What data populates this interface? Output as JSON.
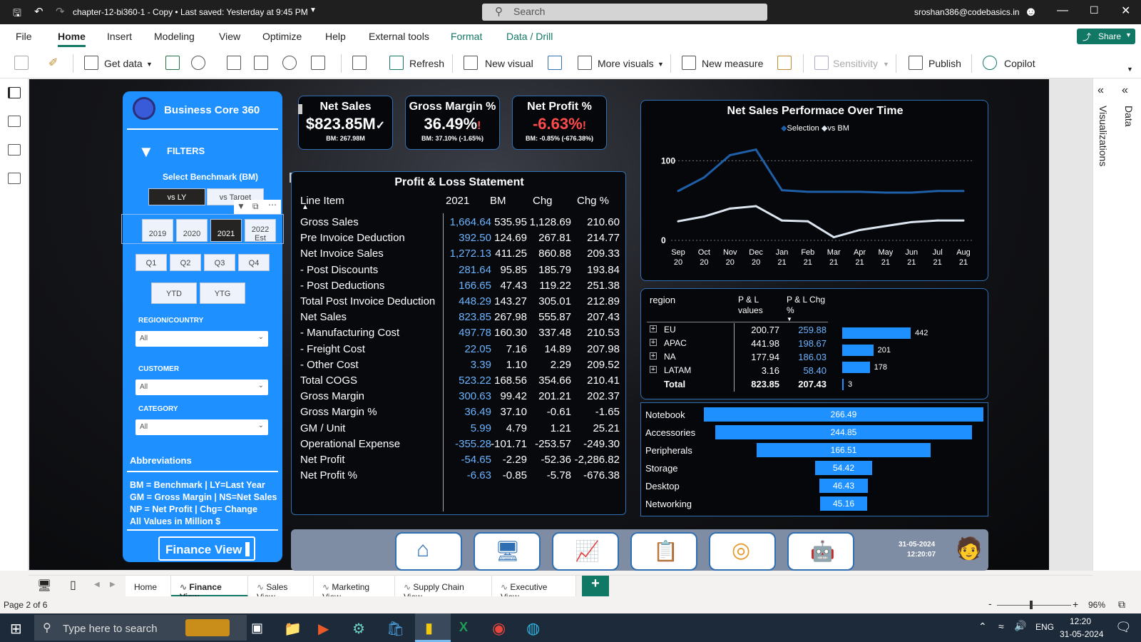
{
  "window": {
    "title": "chapter-12-bi360-1 - Copy • Last saved: Yesterday at 9:45 PM",
    "search_placeholder": "Search",
    "user": "sroshan386@codebasics.in"
  },
  "menu": [
    "File",
    "Home",
    "Insert",
    "Modeling",
    "View",
    "Optimize",
    "Help",
    "External tools",
    "Format",
    "Data / Drill"
  ],
  "share_label": "Share",
  "ribbon": {
    "get_data": "Get data",
    "refresh": "Refresh",
    "new_visual": "New visual",
    "more_visuals": "More visuals",
    "new_measure": "New measure",
    "sensitivity": "Sensitivity",
    "publish": "Publish",
    "copilot": "Copilot"
  },
  "right_panes": {
    "visualizations": "Visualizations",
    "data": "Data"
  },
  "sidebar": {
    "brand": "Business Core 360",
    "filters": "FILTERS",
    "benchmark_label": "Select Benchmark (BM)",
    "benchmark_options": [
      "vs LY",
      "vs Target"
    ],
    "years": [
      "2019",
      "2020",
      "2021",
      "2022 Est"
    ],
    "quarters": [
      "Q1",
      "Q2",
      "Q3",
      "Q4"
    ],
    "ytd": "YTD",
    "ytg": "YTG",
    "region_label": "REGION/COUNTRY",
    "region_value": "All",
    "customer_label": "CUSTOMER",
    "customer_value": "All",
    "category_label": "CATEGORY",
    "category_value": "All",
    "abbrev_title": "Abbreviations",
    "abbrev_lines": [
      "BM = Benchmark | LY=Last Year",
      "GM = Gross Margin | NS=Net Sales",
      "NP = Net Profit | Chg= Change",
      "All Values in Million $"
    ],
    "view_button": "Finance View"
  },
  "kpis": [
    {
      "title": "Net Sales",
      "value": "$823.85M",
      "sub": "BM: 267.98M",
      "color": "#ffffff"
    },
    {
      "title": "Gross Margin %",
      "value": "36.49%",
      "sub": "BM: 37.10% (-1.65%)",
      "color": "#ffffff"
    },
    {
      "title": "Net Profit %",
      "value": "-6.63%",
      "sub": "BM: -0.85% (-676.38%)",
      "color": "#ff4b4b"
    }
  ],
  "pl": {
    "title": "Profit & Loss Statement",
    "headers": [
      "Line Item",
      "2021",
      "BM",
      "Chg",
      "Chg %"
    ],
    "rows": [
      [
        "Gross Sales",
        "1,664.64",
        "535.95",
        "1,128.69",
        "210.60"
      ],
      [
        "Pre Invoice Deduction",
        "392.50",
        "124.69",
        "267.81",
        "214.77"
      ],
      [
        "Net Invoice Sales",
        "1,272.13",
        "411.25",
        "860.88",
        "209.33"
      ],
      [
        "- Post Discounts",
        "281.64",
        "95.85",
        "185.79",
        "193.84"
      ],
      [
        "- Post Deductions",
        "166.65",
        "47.43",
        "119.22",
        "251.38"
      ],
      [
        "Total Post Invoice Deduction",
        "448.29",
        "143.27",
        "305.01",
        "212.89"
      ],
      [
        "Net Sales",
        "823.85",
        "267.98",
        "555.87",
        "207.43"
      ],
      [
        "- Manufacturing Cost",
        "497.78",
        "160.30",
        "337.48",
        "210.53"
      ],
      [
        "- Freight Cost",
        "22.05",
        "7.16",
        "14.89",
        "207.98"
      ],
      [
        "- Other Cost",
        "3.39",
        "1.10",
        "2.29",
        "209.52"
      ],
      [
        "Total COGS",
        "523.22",
        "168.56",
        "354.66",
        "210.41"
      ],
      [
        "Gross Margin",
        "300.63",
        "99.42",
        "201.21",
        "202.37"
      ],
      [
        "Gross Margin %",
        "36.49",
        "37.10",
        "-0.61",
        "-1.65"
      ],
      [
        "GM / Unit",
        "5.99",
        "4.79",
        "1.21",
        "25.21"
      ],
      [
        "Operational Expense",
        "-355.28",
        "-101.71",
        "-253.57",
        "-249.30"
      ],
      [
        "Net Profit",
        "-54.65",
        "-2.29",
        "-52.36",
        "-2,286.82"
      ],
      [
        "Net Profit %",
        "-6.63",
        "-0.85",
        "-5.78",
        "-676.38"
      ]
    ]
  },
  "chart_data": [
    {
      "type": "line",
      "title": "Net Sales Performace Over Time",
      "legend": [
        "Selection",
        "vs BM"
      ],
      "legend_position": "top-center",
      "x": [
        "Sep 20",
        "Oct 20",
        "Nov 20",
        "Dec 20",
        "Jan 21",
        "Feb 21",
        "Mar 21",
        "Apr 21",
        "May 21",
        "Jun 21",
        "Jul 21",
        "Aug 21"
      ],
      "yticks": [
        "100",
        "0"
      ],
      "ylim": [
        0,
        120
      ],
      "series": [
        {
          "name": "Selection",
          "color": "#1f5fa8",
          "values": [
            62,
            79,
            107,
            114,
            63,
            61,
            61,
            61,
            60,
            60,
            62,
            62
          ]
        },
        {
          "name": "vs BM",
          "color": "#dde6f0",
          "values": [
            24,
            30,
            40,
            43,
            25,
            24,
            4,
            13,
            18,
            23,
            25,
            25
          ]
        }
      ]
    },
    {
      "type": "bar",
      "orientation": "horizontal",
      "categories": [
        "Notebook",
        "Accessories",
        "Peripherals",
        "Storage",
        "Desktop",
        "Networking"
      ],
      "values": [
        266.49,
        244.85,
        166.51,
        54.42,
        46.43,
        45.16
      ],
      "value_labels": [
        "266.49",
        "244.85",
        "166.51",
        "54.42",
        "46.43",
        "45.16"
      ]
    }
  ],
  "region_matrix": {
    "headers": [
      "region",
      "P & L values",
      "P & L Chg %"
    ],
    "rows": [
      {
        "name": "EU",
        "values": "200.77",
        "chg": "259.88",
        "bar_label": "442",
        "bar": 442
      },
      {
        "name": "APAC",
        "values": "441.98",
        "chg": "198.67",
        "bar_label": "201",
        "bar": 201
      },
      {
        "name": "NA",
        "values": "177.94",
        "chg": "186.03",
        "bar_label": "178",
        "bar": 178
      },
      {
        "name": "LATAM",
        "values": "3.16",
        "chg": "58.40",
        "bar_label": "3",
        "bar": 3
      }
    ],
    "total": {
      "name": "Total",
      "values": "823.85",
      "chg": "207.43"
    }
  },
  "nav": {
    "date": "31-05-2024",
    "time": "12:20:07"
  },
  "tabs": [
    "Home",
    "Finance View",
    "Sales View",
    "Marketing View",
    "Supply Chain View",
    "Executive View"
  ],
  "status": {
    "page": "Page 2 of 6",
    "zoom": "96%"
  },
  "taskbar": {
    "search": "Type here to search",
    "lang": "ENG",
    "time": "12:20",
    "date": "31-05-2024"
  },
  "colors": {
    "accent": "#1e90ff",
    "brand_green": "#117865",
    "negative": "#ff4b4b"
  }
}
